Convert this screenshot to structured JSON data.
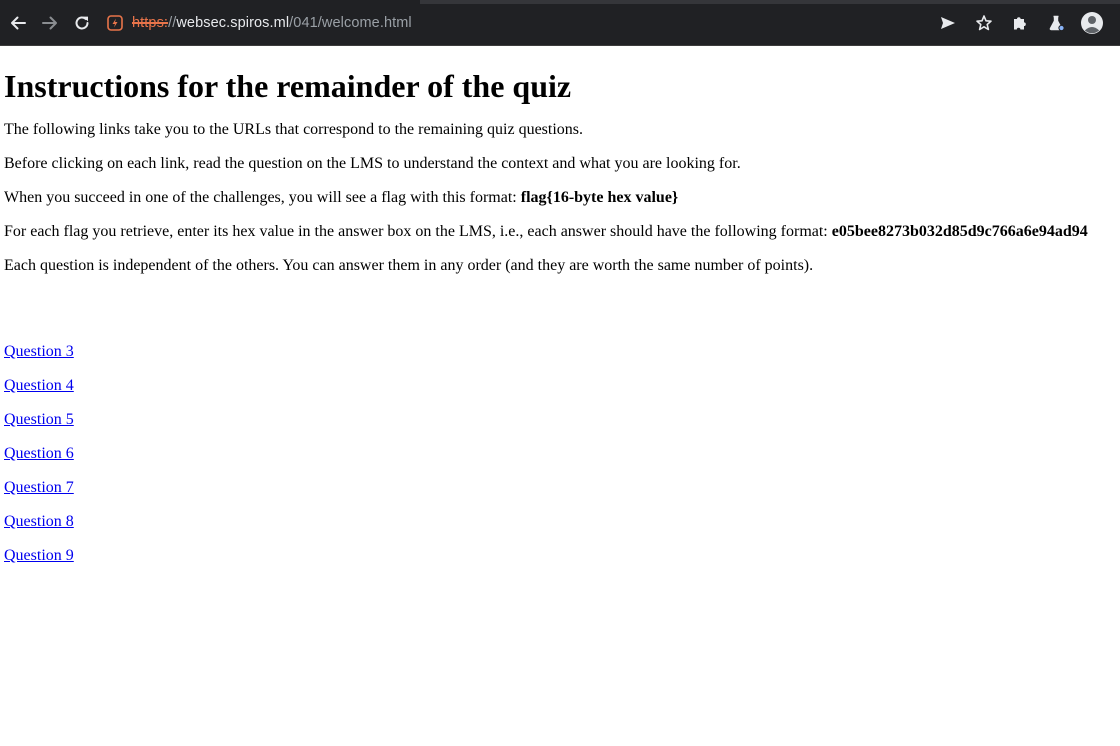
{
  "browser": {
    "url_scheme": "https:",
    "url_separator": "//",
    "url_host": "websec.spiros.ml",
    "url_path": "/041/welcome.html",
    "icons": {
      "back": "arrow-left-icon",
      "forward": "arrow-right-icon",
      "reload": "reload-icon",
      "security": "not-secure-icon",
      "send": "send-icon",
      "bookmark": "star-icon",
      "extensions": "puzzle-icon",
      "labs": "flask-icon",
      "profile": "avatar-icon"
    },
    "colors": {
      "toolbar_bg": "#202124",
      "insecure": "#e8744a",
      "icon": "#e8eaed"
    }
  },
  "page": {
    "heading": "Instructions for the remainder of the quiz",
    "p1": "The following links take you to the URLs that correspond to the remaining quiz questions.",
    "p2": "Before clicking on each link, read the question on the LMS to understand the context and what you are looking for.",
    "p3_text": "When you succeed in one of the challenges, you will see a flag with this format: ",
    "p3_bold": "flag{16-byte hex value}",
    "p4_text": "For each flag you retrieve, enter its hex value in the answer box on the LMS, i.e., each answer should have the following format: ",
    "p4_bold": "e05bee8273b032d85d9c766a6e94ad94",
    "p5": "Each question is independent of the others. You can answer them in any order (and they are worth the same number of points).",
    "links": [
      "Question 3",
      "Question 4",
      "Question 5",
      "Question 6",
      "Question 7",
      "Question 8",
      "Question 9"
    ]
  }
}
